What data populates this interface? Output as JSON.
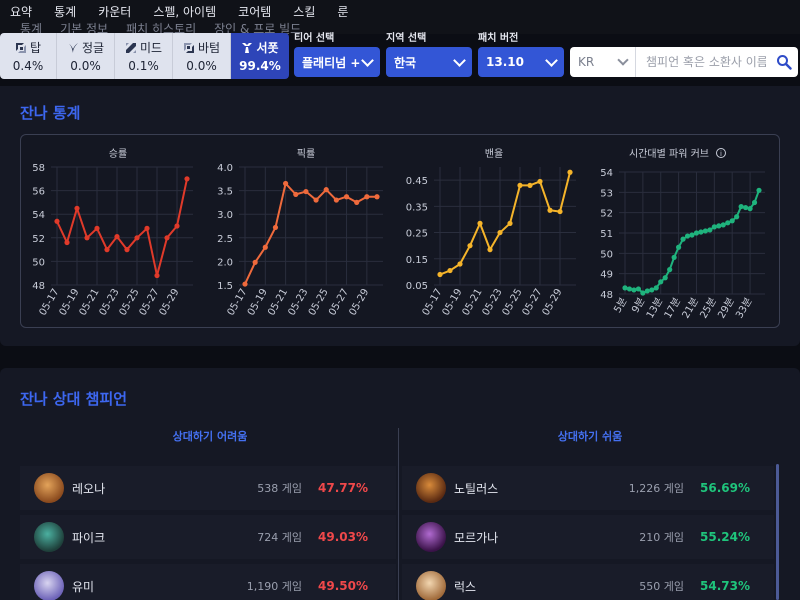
{
  "nav": {
    "items": [
      "요약",
      "통계",
      "카운터",
      "스펠, 아이템",
      "코어템",
      "스킬",
      "룬"
    ],
    "sub_items": [
      "통계",
      "기본 정보",
      "패치 히스토리",
      "장인 & 프로 빌드"
    ]
  },
  "lanes": [
    {
      "label": "탑",
      "pct": "0.4%",
      "icon": "top-lane-icon"
    },
    {
      "label": "정글",
      "pct": "0.0%",
      "icon": "jungle-lane-icon"
    },
    {
      "label": "미드",
      "pct": "0.1%",
      "icon": "mid-lane-icon"
    },
    {
      "label": "바텀",
      "pct": "0.0%",
      "icon": "bottom-lane-icon"
    },
    {
      "label": "서폿",
      "pct": "99.4%",
      "icon": "support-lane-icon"
    }
  ],
  "filters": {
    "tier": {
      "label": "티어 선택",
      "value": "플래티넘 +"
    },
    "region": {
      "label": "지역 선택",
      "value": "한국"
    },
    "patch": {
      "label": "패치 버전",
      "value": "13.10"
    }
  },
  "search": {
    "region": "KR",
    "placeholder": "챔피언 혹은 소환사 이름"
  },
  "stats": {
    "title": "잔나 통계"
  },
  "chart_data": [
    {
      "type": "line",
      "title": "승률",
      "x": [
        "05-17",
        "05-18",
        "05-19",
        "05-20",
        "05-21",
        "05-22",
        "05-23",
        "05-24",
        "05-25",
        "05-26",
        "05-27",
        "05-28",
        "05-29",
        "05-30"
      ],
      "x_ticks": [
        "05-17",
        "05-19",
        "05-21",
        "05-23",
        "05-25",
        "05-27",
        "05-29"
      ],
      "values": [
        53.4,
        51.6,
        54.5,
        52.0,
        52.8,
        51.0,
        52.1,
        51.0,
        52.0,
        52.8,
        48.8,
        52.0,
        53.0,
        57.0
      ],
      "ylim": [
        48,
        58
      ],
      "yticks": [
        48,
        50,
        52,
        54,
        56,
        58
      ],
      "color": "#e03a2a"
    },
    {
      "type": "line",
      "title": "픽률",
      "x": [
        "05-17",
        "05-18",
        "05-19",
        "05-20",
        "05-21",
        "05-22",
        "05-23",
        "05-24",
        "05-25",
        "05-26",
        "05-27",
        "05-28",
        "05-29",
        "05-30"
      ],
      "x_ticks": [
        "05-17",
        "05-19",
        "05-21",
        "05-23",
        "05-25",
        "05-27",
        "05-29"
      ],
      "values": [
        1.52,
        1.98,
        2.3,
        2.72,
        3.65,
        3.42,
        3.48,
        3.3,
        3.52,
        3.3,
        3.37,
        3.25,
        3.37,
        3.37
      ],
      "ylim": [
        1.5,
        4.0
      ],
      "yticks": [
        "1.5",
        "2.0",
        "2.5",
        "3.0",
        "3.5",
        "4.0"
      ],
      "color": "#ef6a3c"
    },
    {
      "type": "line",
      "title": "밴율",
      "x": [
        "05-17",
        "05-18",
        "05-19",
        "05-20",
        "05-21",
        "05-22",
        "05-23",
        "05-24",
        "05-25",
        "05-26",
        "05-27",
        "05-28",
        "05-29",
        "05-30"
      ],
      "x_ticks": [
        "05-17",
        "05-19",
        "05-21",
        "05-23",
        "05-25",
        "05-27",
        "05-29"
      ],
      "values": [
        0.09,
        0.105,
        0.13,
        0.2,
        0.285,
        0.185,
        0.25,
        0.285,
        0.43,
        0.43,
        0.445,
        0.335,
        0.33,
        0.48
      ],
      "ylim": [
        0.05,
        0.5
      ],
      "yticks": [
        "0.05",
        "0.15",
        "0.25",
        "0.35",
        "0.45"
      ],
      "color": "#f5b42a"
    },
    {
      "type": "line",
      "title": "시간대별 파워 커브",
      "x": [
        5,
        6,
        7,
        8,
        9,
        10,
        11,
        12,
        13,
        14,
        15,
        16,
        17,
        18,
        19,
        20,
        21,
        22,
        23,
        24,
        25,
        26,
        27,
        28,
        29,
        30,
        31,
        32,
        33,
        34,
        35
      ],
      "x_ticks": [
        "5분",
        "9분",
        "13분",
        "17분",
        "21분",
        "25분",
        "29분",
        "33분"
      ],
      "x_tick_values": [
        5,
        9,
        13,
        17,
        21,
        25,
        29,
        33
      ],
      "values": [
        48.3,
        48.25,
        48.2,
        48.25,
        48.05,
        48.15,
        48.2,
        48.3,
        48.6,
        48.8,
        49.2,
        49.8,
        50.3,
        50.7,
        50.85,
        50.9,
        51.0,
        51.05,
        51.1,
        51.15,
        51.3,
        51.35,
        51.4,
        51.5,
        51.6,
        51.8,
        52.3,
        52.25,
        52.2,
        52.5,
        53.1
      ],
      "ylim": [
        48,
        54
      ],
      "yticks": [
        48,
        49,
        50,
        51,
        52,
        53,
        54
      ],
      "color": "#1fb37d"
    }
  ],
  "counters": {
    "title": "잔나 상대 챔피언",
    "hard_label": "상대하기 어려움",
    "easy_label": "상대하기 쉬움",
    "hard": [
      {
        "name": "레오나",
        "games": "538 게임",
        "winrate": "47.77%"
      },
      {
        "name": "파이크",
        "games": "724 게임",
        "winrate": "49.03%"
      },
      {
        "name": "유미",
        "games": "1,190 게임",
        "winrate": "49.50%"
      }
    ],
    "easy": [
      {
        "name": "노틸러스",
        "games": "1,226 게임",
        "winrate": "56.69%"
      },
      {
        "name": "모르가나",
        "games": "210 게임",
        "winrate": "55.24%"
      },
      {
        "name": "럭스",
        "games": "550 게임",
        "winrate": "54.73%"
      }
    ],
    "hard_color": "#f0484a",
    "easy_color": "#1fc47c"
  }
}
